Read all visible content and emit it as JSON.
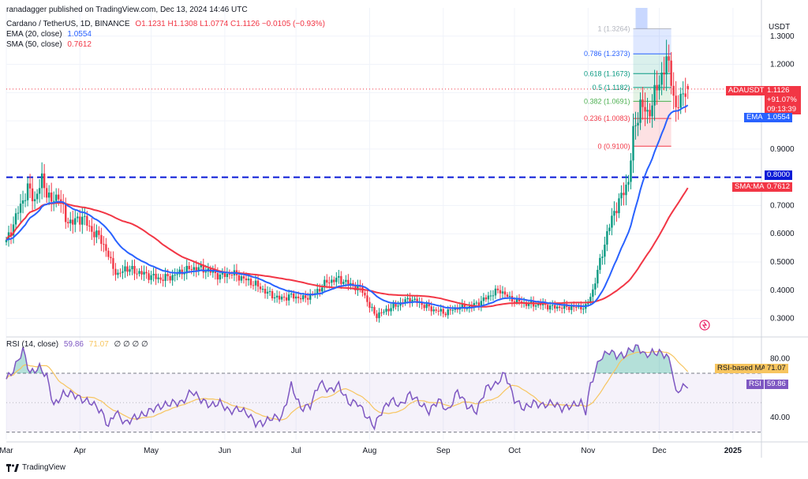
{
  "header": {
    "publisher": "ranadagger published on TradingView.com, Dec 13, 2024 14:46 UTC",
    "symbol_line": "Cardano / TetherUS, 1D, BINANCE",
    "ohlc": "O1.1231 H1.1308 L1.0774 C1.1126 −0.0105 (−0.93%)",
    "ema_label": "EMA (20, close)",
    "ema_value": "1.0554",
    "sma_label": "SMA (50, close)",
    "sma_value": "0.7612",
    "rsi_label": "RSI (14, close)",
    "rsi_value": "59.86",
    "rsi_ma_value": "71.07",
    "rsi_extra": "∅ ∅ ∅ ∅",
    "currency": "USDT"
  },
  "price_labels": {
    "adausdt": "ADAUSDT",
    "last_price": "1.1126",
    "change": "+91.07%",
    "countdown": "09:13:39",
    "ema_tag": "EMA",
    "ema_price": "1.0554",
    "level_price": "0.8000",
    "sma_tag": "SMA:MA",
    "sma_price": "0.7612",
    "rsi_ma_tag": "RSI-based MA",
    "rsi_ma_val": "71.07",
    "rsi_tag": "RSI",
    "rsi_val": "59.86"
  },
  "fib_levels": [
    {
      "label": "1 (1.3264)",
      "value": 1.3264
    },
    {
      "label": "0.786 (1.2373)",
      "value": 1.2373
    },
    {
      "label": "0.618 (1.1673)",
      "value": 1.1673
    },
    {
      "label": "0.5 (1.1182)",
      "value": 1.1182
    },
    {
      "label": "0.382 (1.0691)",
      "value": 1.0691
    },
    {
      "label": "0.236 (1.0083)",
      "value": 1.0083
    },
    {
      "label": "0 (0.9100)",
      "value": 0.91
    }
  ],
  "footer": {
    "brand": "TradingView"
  },
  "colors": {
    "up": "#089981",
    "down": "#f23645",
    "ema": "#2962ff",
    "sma": "#f23645",
    "rsi": "#7e57c2",
    "rsi_ma": "#f7c55f",
    "level": "#0b1bd6",
    "grid": "#f0f3fa"
  },
  "chart_data": {
    "type": "candlestick",
    "title": "Cardano / TetherUS, 1D, BINANCE",
    "price_axis": {
      "ticks": [
        0.3,
        0.4,
        0.5,
        0.6,
        0.7,
        0.8,
        0.9,
        1.0,
        1.1,
        1.2,
        1.3
      ],
      "labels": [
        "0.3000",
        "0.4000",
        "0.5000",
        "0.6000",
        "0.7000",
        "0.8000",
        "0.9000",
        "1.0000",
        "1.1000",
        "1.2000",
        "1.3000"
      ],
      "range": [
        0.24,
        1.4
      ]
    },
    "rsi_axis": {
      "ticks": [
        40,
        80
      ],
      "labels": [
        "40.00",
        "80.00"
      ],
      "bands": [
        30,
        70
      ],
      "range": [
        25,
        93
      ]
    },
    "time_axis": {
      "labels": [
        "Mar",
        "Apr",
        "May",
        "Jun",
        "Jul",
        "Aug",
        "Sep",
        "Oct",
        "Nov",
        "Dec",
        "2025"
      ],
      "label_days": [
        0,
        31,
        61,
        92,
        122,
        153,
        184,
        214,
        245,
        275,
        306
      ]
    },
    "horizontal_level": 0.8,
    "price_key": [
      [
        0,
        0.57
      ],
      [
        5,
        0.68
      ],
      [
        9,
        0.76
      ],
      [
        12,
        0.72
      ],
      [
        15,
        0.79
      ],
      [
        19,
        0.71
      ],
      [
        22,
        0.74
      ],
      [
        25,
        0.65
      ],
      [
        28,
        0.64
      ],
      [
        32,
        0.66
      ],
      [
        36,
        0.61
      ],
      [
        40,
        0.58
      ],
      [
        44,
        0.5
      ],
      [
        47,
        0.45
      ],
      [
        50,
        0.48
      ],
      [
        53,
        0.47
      ],
      [
        57,
        0.46
      ],
      [
        61,
        0.45
      ],
      [
        65,
        0.44
      ],
      [
        70,
        0.45
      ],
      [
        75,
        0.47
      ],
      [
        80,
        0.48
      ],
      [
        85,
        0.47
      ],
      [
        90,
        0.45
      ],
      [
        95,
        0.46
      ],
      [
        100,
        0.44
      ],
      [
        105,
        0.42
      ],
      [
        110,
        0.39
      ],
      [
        115,
        0.37
      ],
      [
        120,
        0.38
      ],
      [
        125,
        0.37
      ],
      [
        130,
        0.39
      ],
      [
        135,
        0.43
      ],
      [
        140,
        0.44
      ],
      [
        145,
        0.42
      ],
      [
        150,
        0.4
      ],
      [
        153,
        0.34
      ],
      [
        156,
        0.31
      ],
      [
        160,
        0.33
      ],
      [
        165,
        0.35
      ],
      [
        170,
        0.37
      ],
      [
        175,
        0.35
      ],
      [
        180,
        0.33
      ],
      [
        185,
        0.32
      ],
      [
        190,
        0.34
      ],
      [
        195,
        0.34
      ],
      [
        200,
        0.36
      ],
      [
        205,
        0.39
      ],
      [
        208,
        0.4
      ],
      [
        212,
        0.37
      ],
      [
        216,
        0.36
      ],
      [
        220,
        0.35
      ],
      [
        225,
        0.35
      ],
      [
        230,
        0.34
      ],
      [
        235,
        0.34
      ],
      [
        240,
        0.34
      ],
      [
        244,
        0.34
      ],
      [
        247,
        0.4
      ],
      [
        250,
        0.5
      ],
      [
        253,
        0.6
      ],
      [
        256,
        0.68
      ],
      [
        259,
        0.73
      ],
      [
        262,
        0.79
      ],
      [
        264,
        0.95
      ],
      [
        267,
        1.06
      ],
      [
        270,
        1.02
      ],
      [
        273,
        1.09
      ],
      [
        275,
        1.14
      ],
      [
        278,
        1.21
      ],
      [
        280,
        1.16
      ],
      [
        282,
        1.03
      ],
      [
        284,
        1.08
      ],
      [
        286,
        1.12
      ],
      [
        287,
        1.1126
      ]
    ],
    "ema20_final": 1.0554,
    "sma50_final": 0.7612,
    "rsi_key": [
      [
        0,
        66
      ],
      [
        3,
        72
      ],
      [
        7,
        86
      ],
      [
        10,
        70
      ],
      [
        14,
        74
      ],
      [
        17,
        68
      ],
      [
        20,
        48
      ],
      [
        24,
        56
      ],
      [
        28,
        56
      ],
      [
        32,
        52
      ],
      [
        36,
        50
      ],
      [
        40,
        44
      ],
      [
        43,
        34
      ],
      [
        46,
        44
      ],
      [
        50,
        36
      ],
      [
        54,
        40
      ],
      [
        58,
        42
      ],
      [
        62,
        46
      ],
      [
        66,
        48
      ],
      [
        70,
        50
      ],
      [
        74,
        50
      ],
      [
        78,
        58
      ],
      [
        82,
        52
      ],
      [
        86,
        48
      ],
      [
        90,
        50
      ],
      [
        94,
        44
      ],
      [
        98,
        46
      ],
      [
        102,
        42
      ],
      [
        105,
        36
      ],
      [
        108,
        36
      ],
      [
        112,
        40
      ],
      [
        116,
        40
      ],
      [
        120,
        62
      ],
      [
        124,
        46
      ],
      [
        128,
        48
      ],
      [
        132,
        64
      ],
      [
        136,
        58
      ],
      [
        140,
        62
      ],
      [
        144,
        50
      ],
      [
        148,
        50
      ],
      [
        152,
        40
      ],
      [
        155,
        34
      ],
      [
        158,
        44
      ],
      [
        162,
        52
      ],
      [
        166,
        48
      ],
      [
        170,
        56
      ],
      [
        174,
        50
      ],
      [
        178,
        44
      ],
      [
        182,
        52
      ],
      [
        186,
        44
      ],
      [
        190,
        58
      ],
      [
        194,
        48
      ],
      [
        198,
        44
      ],
      [
        202,
        60
      ],
      [
        206,
        62
      ],
      [
        210,
        70
      ],
      [
        214,
        52
      ],
      [
        218,
        46
      ],
      [
        222,
        50
      ],
      [
        226,
        48
      ],
      [
        230,
        50
      ],
      [
        234,
        46
      ],
      [
        238,
        48
      ],
      [
        242,
        50
      ],
      [
        244,
        44
      ],
      [
        246,
        62
      ],
      [
        250,
        80
      ],
      [
        254,
        85
      ],
      [
        257,
        82
      ],
      [
        260,
        82
      ],
      [
        263,
        86
      ],
      [
        266,
        88
      ],
      [
        269,
        82
      ],
      [
        272,
        84
      ],
      [
        275,
        84
      ],
      [
        278,
        82
      ],
      [
        280,
        76
      ],
      [
        282,
        56
      ],
      [
        284,
        60
      ],
      [
        286,
        61
      ],
      [
        287,
        59.86
      ]
    ],
    "rsi_ma_final": 71.07
  }
}
